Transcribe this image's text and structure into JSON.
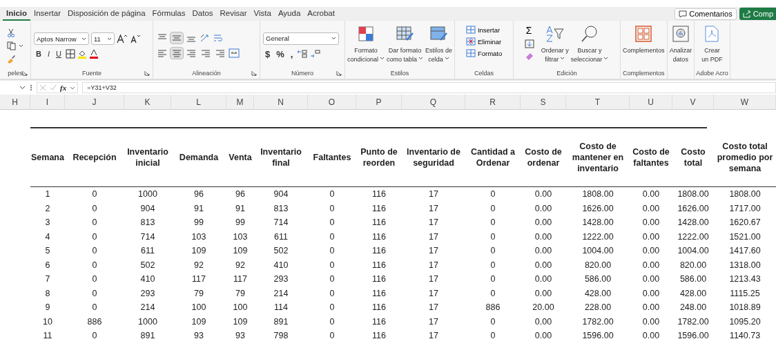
{
  "tabs": [
    {
      "label": "Inicio",
      "selected": true
    },
    {
      "label": "Insertar",
      "selected": false
    },
    {
      "label": "Disposición de página",
      "selected": false
    },
    {
      "label": "Fórmulas",
      "selected": false
    },
    {
      "label": "Datos",
      "selected": false
    },
    {
      "label": "Revisar",
      "selected": false
    },
    {
      "label": "Vista",
      "selected": false
    },
    {
      "label": "Ayuda",
      "selected": false
    },
    {
      "label": "Acrobat",
      "selected": false
    }
  ],
  "comments_button": "Comentarios",
  "share_button": "Comp",
  "ribbon": [
    {
      "kind": "clipboard",
      "title": "peles"
    },
    {
      "kind": "font",
      "title": "Fuente",
      "font_name": "Aptos Narrow",
      "font_size": "11",
      "styles": [
        "B",
        "I",
        "U"
      ]
    },
    {
      "kind": "alignment",
      "title": "Alineación"
    },
    {
      "kind": "number",
      "title": "Número",
      "format": "General",
      "symbols": [
        "$",
        "%",
        ","
      ]
    },
    {
      "kind": "large",
      "title": "Estilos",
      "buttons": [
        {
          "kind": "conditional",
          "lines": [
            "Formato",
            "condicional"
          ],
          "dropdown": true
        },
        {
          "kind": "table",
          "lines": [
            "Dar formato",
            "como tabla"
          ],
          "dropdown": true
        },
        {
          "kind": "cellstyle",
          "lines": [
            "Estilos de",
            "celda"
          ],
          "dropdown": true
        }
      ]
    },
    {
      "kind": "cells",
      "title": "Celdas",
      "items": [
        {
          "kind": "insert",
          "label": "Insertar"
        },
        {
          "kind": "delete",
          "label": "Eliminar"
        },
        {
          "kind": "format",
          "label": "Formato"
        }
      ]
    },
    {
      "kind": "editing",
      "title": "Edición",
      "sum": "Σ",
      "buttons": [
        {
          "kind": "sort",
          "lines": [
            "Ordenar y",
            "filtrar"
          ],
          "dropdown": true
        },
        {
          "kind": "find",
          "lines": [
            "Buscar y",
            "seleccionar"
          ],
          "dropdown": true
        }
      ]
    },
    {
      "kind": "large",
      "title": "Complementos",
      "buttons": [
        {
          "kind": "addins",
          "lines": [
            "Complementos"
          ],
          "dropdown": false
        }
      ]
    },
    {
      "kind": "large",
      "buttons": [
        {
          "kind": "analyze",
          "lines": [
            "Analizar",
            "datos"
          ],
          "dropdown": false
        }
      ]
    },
    {
      "kind": "large",
      "title": "Adobe Acro",
      "buttons": [
        {
          "kind": "pdf",
          "lines": [
            "Crear",
            "un PDF"
          ],
          "dropdown": false
        }
      ]
    }
  ],
  "formula_bar": {
    "fx": "fx",
    "formula": "=Y31+V32"
  },
  "column_letters": [
    "H",
    "I",
    "J",
    "K",
    "L",
    "M",
    "N",
    "O",
    "P",
    "Q",
    "R",
    "S",
    "T",
    "U",
    "V",
    "W"
  ],
  "table": {
    "columns": [
      "Semana",
      "Recepción",
      "Inventario inicial",
      "Demanda",
      "Venta",
      "Inventario final",
      "Faltantes",
      "Punto de reorden",
      "Inventario de seguridad",
      "Cantidad a Ordenar",
      "Costo de ordenar",
      "Costo de mantener en inventario",
      "Costo de faltantes",
      "Costo total",
      "Costo total promedio por semana"
    ],
    "rows": [
      [
        "1",
        "0",
        "1000",
        "96",
        "96",
        "904",
        "0",
        "116",
        "17",
        "0",
        "0.00",
        "1808.00",
        "0.00",
        "1808.00",
        "1808.00"
      ],
      [
        "2",
        "0",
        "904",
        "91",
        "91",
        "813",
        "0",
        "116",
        "17",
        "0",
        "0.00",
        "1626.00",
        "0.00",
        "1626.00",
        "1717.00"
      ],
      [
        "3",
        "0",
        "813",
        "99",
        "99",
        "714",
        "0",
        "116",
        "17",
        "0",
        "0.00",
        "1428.00",
        "0.00",
        "1428.00",
        "1620.67"
      ],
      [
        "4",
        "0",
        "714",
        "103",
        "103",
        "611",
        "0",
        "116",
        "17",
        "0",
        "0.00",
        "1222.00",
        "0.00",
        "1222.00",
        "1521.00"
      ],
      [
        "5",
        "0",
        "611",
        "109",
        "109",
        "502",
        "0",
        "116",
        "17",
        "0",
        "0.00",
        "1004.00",
        "0.00",
        "1004.00",
        "1417.60"
      ],
      [
        "6",
        "0",
        "502",
        "92",
        "92",
        "410",
        "0",
        "116",
        "17",
        "0",
        "0.00",
        "820.00",
        "0.00",
        "820.00",
        "1318.00"
      ],
      [
        "7",
        "0",
        "410",
        "117",
        "117",
        "293",
        "0",
        "116",
        "17",
        "0",
        "0.00",
        "586.00",
        "0.00",
        "586.00",
        "1213.43"
      ],
      [
        "8",
        "0",
        "293",
        "79",
        "79",
        "214",
        "0",
        "116",
        "17",
        "0",
        "0.00",
        "428.00",
        "0.00",
        "428.00",
        "1115.25"
      ],
      [
        "9",
        "0",
        "214",
        "100",
        "100",
        "114",
        "0",
        "116",
        "17",
        "886",
        "20.00",
        "228.00",
        "0.00",
        "248.00",
        "1018.89"
      ],
      [
        "10",
        "886",
        "1000",
        "109",
        "109",
        "891",
        "0",
        "116",
        "17",
        "0",
        "0.00",
        "1782.00",
        "0.00",
        "1782.00",
        "1095.20"
      ],
      [
        "11",
        "0",
        "891",
        "93",
        "93",
        "798",
        "0",
        "116",
        "17",
        "0",
        "0.00",
        "1596.00",
        "0.00",
        "1596.00",
        "1140.73"
      ]
    ]
  }
}
